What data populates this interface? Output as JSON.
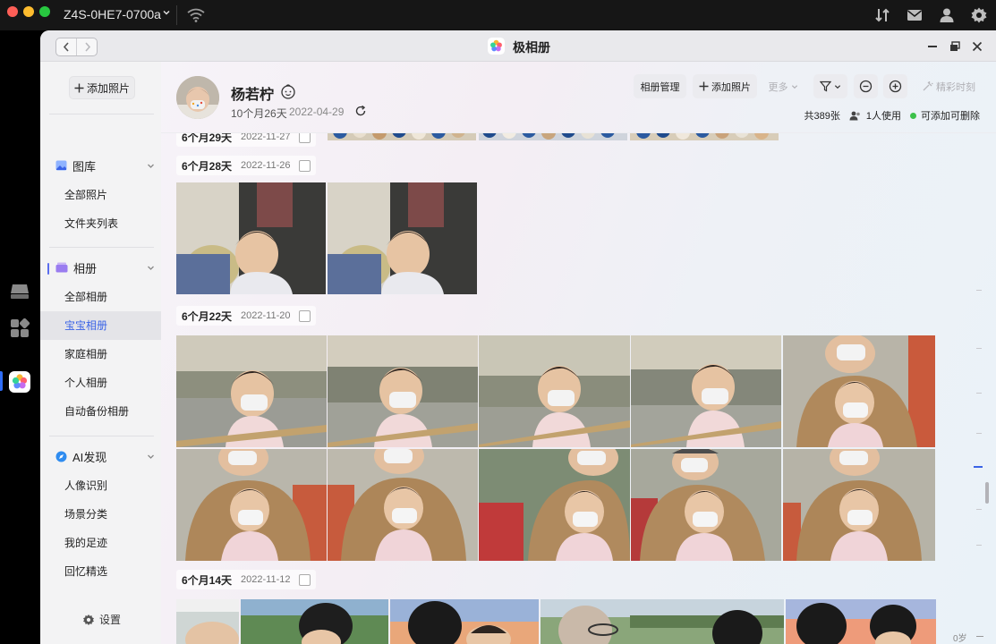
{
  "system_bar": {
    "device_name": "Z4S-0HE7-0700a"
  },
  "window": {
    "title": "极相册"
  },
  "sidebar": {
    "add_photo": "添加照片",
    "sections": [
      {
        "label": "图库",
        "items": [
          "全部照片",
          "文件夹列表"
        ]
      },
      {
        "label": "相册",
        "items": [
          "全部相册",
          "宝宝相册",
          "家庭相册",
          "个人相册",
          "自动备份相册"
        ]
      },
      {
        "label": "AI发现",
        "items": [
          "人像识别",
          "场景分类",
          "我的足迹",
          "回忆精选"
        ]
      }
    ],
    "active_item": "宝宝相册",
    "settings": "设置"
  },
  "album": {
    "name": "杨若柠",
    "age": "10个月26天",
    "date": "2022-04-29",
    "buttons": {
      "manage": "相册管理",
      "add": "添加照片",
      "more": "更多",
      "wonderful": "精彩时刻"
    },
    "stats": {
      "count": "共389张",
      "users": "1人使用",
      "permission": "可添加可删除"
    }
  },
  "groups": [
    {
      "title": "6个月29天",
      "date": "2022-11-27",
      "photos": 4
    },
    {
      "title": "6个月28天",
      "date": "2022-11-26",
      "photos": 2
    },
    {
      "title": "6个月22天",
      "date": "2022-11-20",
      "photos": 10
    },
    {
      "title": "6个月14天",
      "date": "2022-11-12",
      "photos": 5
    }
  ],
  "scroll_rail": {
    "bottom_label": "0岁"
  },
  "colors": {
    "accent": "#3a63e6",
    "green_status": "#3cc14a"
  }
}
